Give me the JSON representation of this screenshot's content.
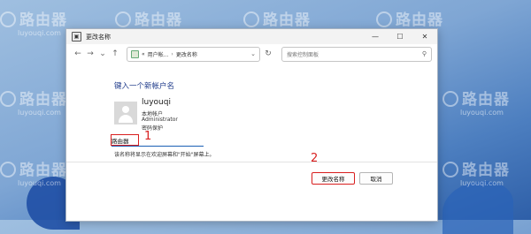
{
  "watermark": {
    "text": "路由器",
    "sub": "luyouqi.com"
  },
  "window": {
    "title": "更改名称",
    "controls": {
      "minimize": "—",
      "maximize": "☐",
      "close": "✕"
    }
  },
  "nav": {
    "back": "←",
    "forward": "→",
    "up": "↑",
    "breadcrumb_lead": "«",
    "breadcrumb_1": "用户帐...",
    "breadcrumb_sep": "›",
    "breadcrumb_2": "更改名称",
    "dropdown": "⌄",
    "refresh": "↻",
    "search_placeholder": "搜索控制面板",
    "search_glyph": "⚲"
  },
  "content": {
    "heading": "键入一个新帐户名",
    "account": {
      "name": "luyouqi",
      "type": "本地帐户",
      "role": "Administrator",
      "protection": "密码保护"
    },
    "new_name_value": "路由器",
    "hint": "该名称将显示在欢迎屏幕和\"开始\"屏幕上。"
  },
  "annotations": {
    "step1": "1",
    "step2": "2"
  },
  "buttons": {
    "change": "更改名称",
    "cancel": "取消"
  }
}
